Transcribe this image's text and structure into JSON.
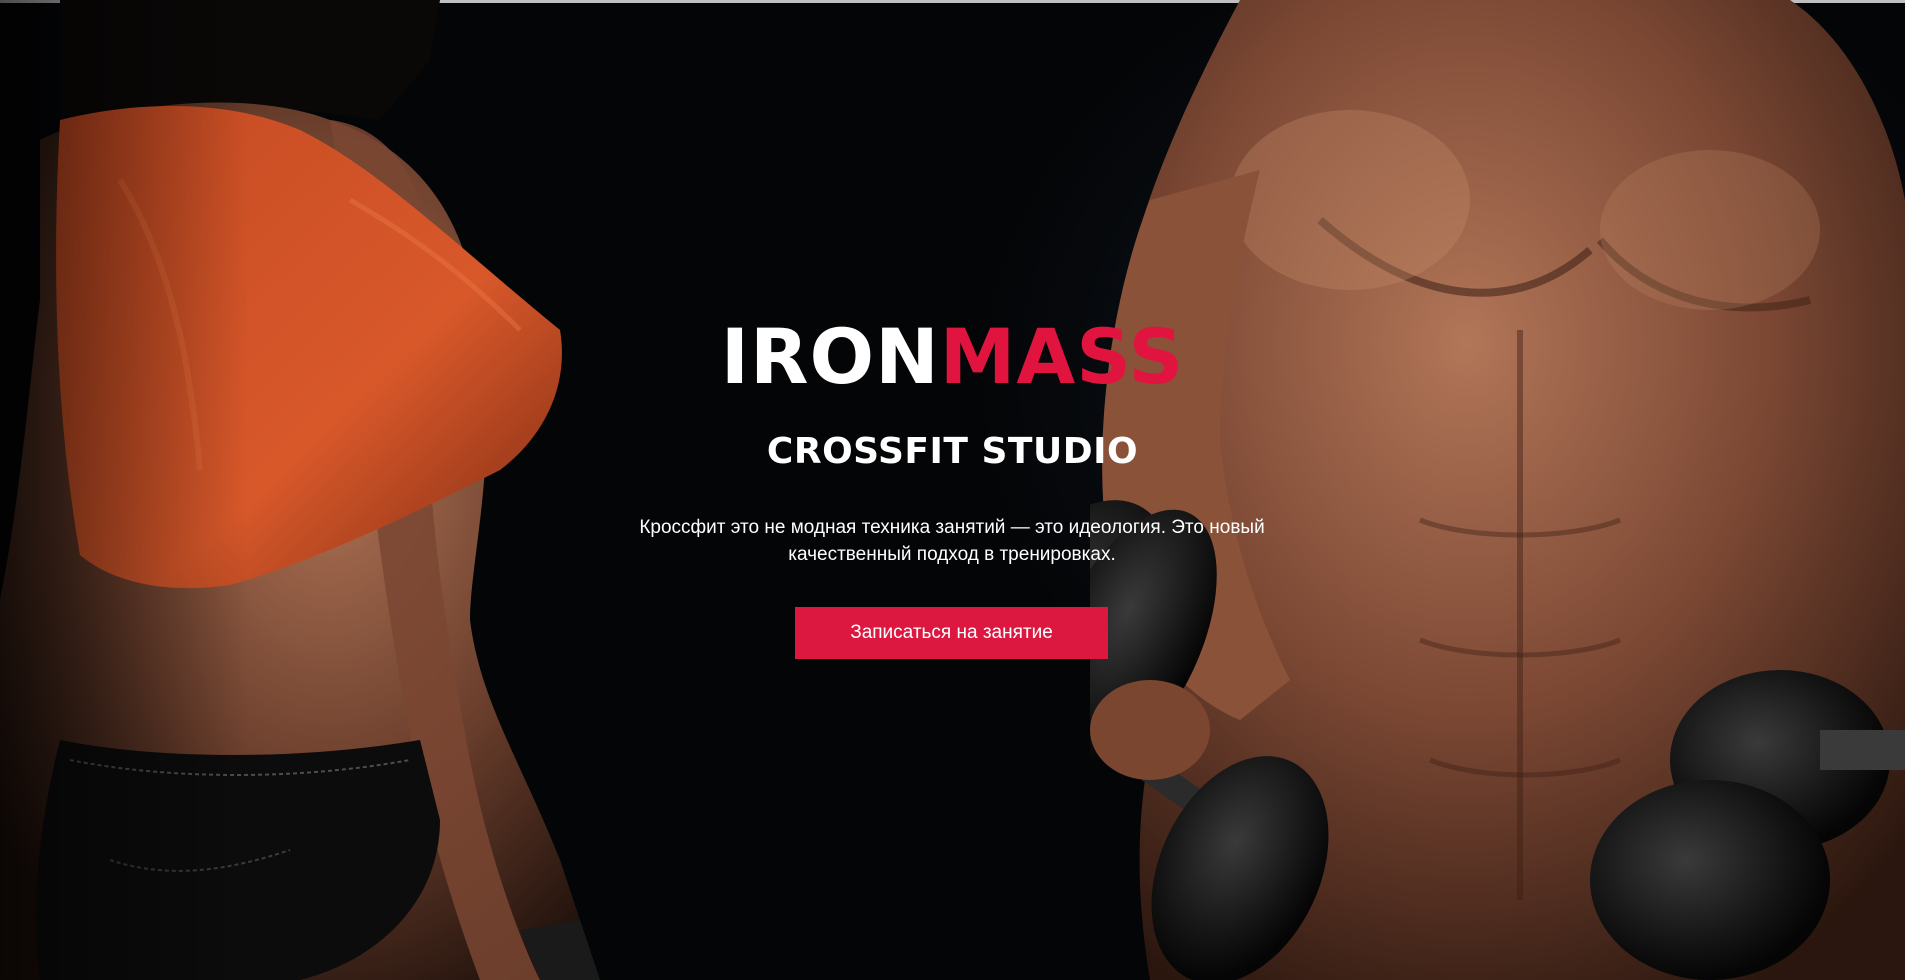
{
  "hero": {
    "logo": {
      "part1": "IRON",
      "part2": "MASS"
    },
    "subtitle": "CROSSFIT STUDIO",
    "description": "Кроссфит это не модная техника занятий — это идеология. Это новый качественный подход в тренировках.",
    "cta_label": "Записаться на занятие",
    "colors": {
      "accent": "#dc1840",
      "logo_accent": "#e0143f",
      "background": "#040507",
      "text": "#ffffff"
    }
  }
}
